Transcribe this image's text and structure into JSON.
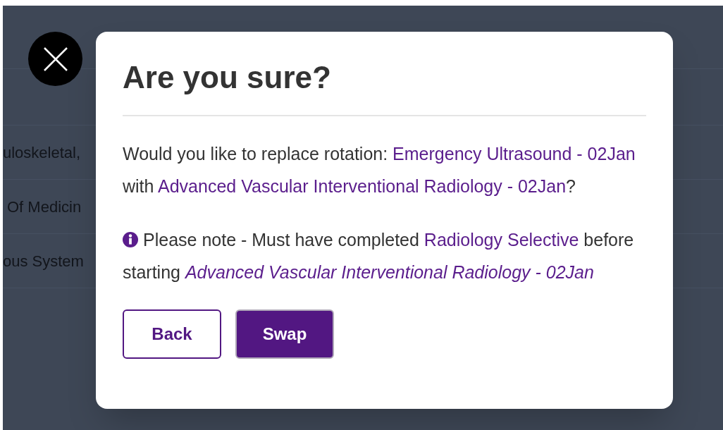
{
  "background": {
    "rows": [
      "uloskeletal,",
      "Of Medicin",
      "ous System"
    ]
  },
  "dialog": {
    "title": "Are you sure?",
    "paragraphs": [
      {
        "info": false,
        "segments": [
          {
            "kind": "text",
            "text": "Would you like to replace rotation: "
          },
          {
            "kind": "link",
            "text": "Emergency Ultrasound - 02Jan"
          },
          {
            "kind": "text",
            "text": " with "
          },
          {
            "kind": "link",
            "text": "Advanced Vascular Interventional Radiology - 02Jan"
          },
          {
            "kind": "text",
            "text": "?"
          }
        ]
      },
      {
        "info": true,
        "segments": [
          {
            "kind": "text",
            "text": "Please note - Must have completed "
          },
          {
            "kind": "link",
            "text": "Radiology Selective"
          },
          {
            "kind": "text",
            "text": " before starting "
          },
          {
            "kind": "italic_link",
            "text": "Advanced Vascular Interventional Radiology - 02Jan"
          }
        ]
      }
    ],
    "buttons": [
      {
        "label": "Back",
        "kind": "secondary"
      },
      {
        "label": "Swap",
        "kind": "primary"
      }
    ]
  }
}
